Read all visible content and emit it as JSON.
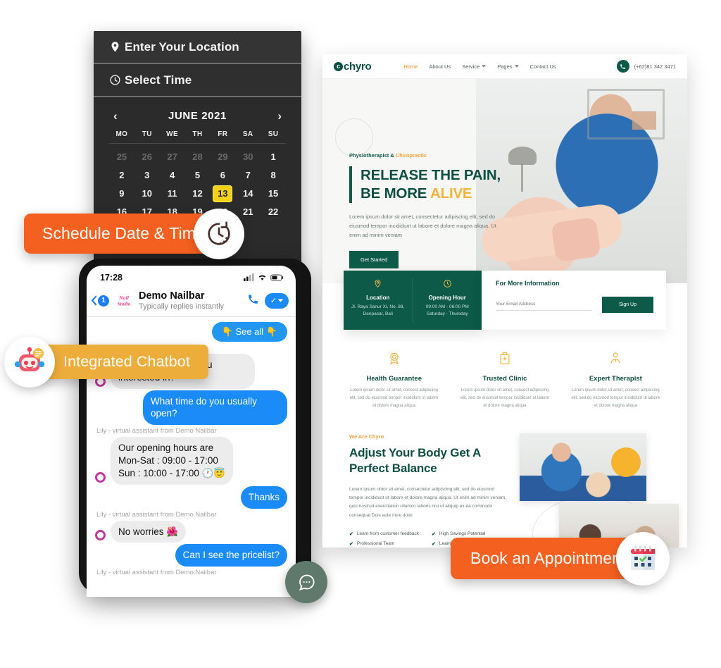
{
  "scheduler": {
    "location_row": {
      "label": "Enter Your Location",
      "icon": "map-pin-icon"
    },
    "time_row": {
      "label": "Select Time",
      "icon": "clock-icon"
    },
    "calendar": {
      "month_label": "JUNE 2021",
      "prev": "‹",
      "next": "›",
      "day_headers": [
        "MO",
        "TU",
        "WE",
        "TH",
        "FR",
        "SA",
        "SU"
      ],
      "weeks": [
        [
          {
            "d": "25",
            "muted": true
          },
          {
            "d": "26",
            "muted": true
          },
          {
            "d": "27",
            "muted": true
          },
          {
            "d": "28",
            "muted": true
          },
          {
            "d": "29",
            "muted": true
          },
          {
            "d": "30",
            "muted": true
          },
          {
            "d": "1",
            "muted": false
          }
        ],
        [
          {
            "d": "2"
          },
          {
            "d": "3"
          },
          {
            "d": "4"
          },
          {
            "d": "5"
          },
          {
            "d": "6"
          },
          {
            "d": "7"
          },
          {
            "d": "8"
          }
        ],
        [
          {
            "d": "9"
          },
          {
            "d": "10"
          },
          {
            "d": "11"
          },
          {
            "d": "12"
          },
          {
            "d": "13",
            "selected": true
          },
          {
            "d": "14"
          },
          {
            "d": "15"
          }
        ],
        [
          {
            "d": "16"
          },
          {
            "d": "17"
          },
          {
            "d": "18"
          },
          {
            "d": "19"
          },
          {
            "d": "20"
          },
          {
            "d": "21"
          },
          {
            "d": "22"
          }
        ]
      ],
      "selected_day": "13",
      "selected_color": "#f5d214"
    }
  },
  "phone": {
    "status": {
      "time": "17:28",
      "signal": "signal-icon",
      "wifi": "wifi-icon",
      "battery": "battery-icon"
    },
    "header": {
      "back_badge": "1",
      "brand_logo": "Nail Studio",
      "title": "Demo Nailbar",
      "subtitle": "Typically replies instantly",
      "call_icon": "phone-icon",
      "check_label": "✓"
    },
    "see_all": "👇 See all 👇",
    "messages": [
      {
        "sender": "Demo Nailbar",
        "side": "them",
        "text": "What services are you interested in?"
      },
      {
        "sender": "",
        "side": "me",
        "text": "What time do you usually open?"
      },
      {
        "sender": "Lily - virtual assistant from Demo Nailbar",
        "side": "them",
        "text": "Our opening hours are\nMon-Sat : 09:00 - 17:00\nSun : 10:00 - 17:00 🕐😇"
      },
      {
        "sender": "",
        "side": "me",
        "text": "Thanks"
      },
      {
        "sender": "Lily - virtual assistant from Demo Nailbar",
        "side": "them",
        "text": "No worries 🌺"
      },
      {
        "sender": "",
        "side": "me",
        "text": "Can I see the pricelist?"
      },
      {
        "sender": "Lily - virtual assistant from Demo Nailbar",
        "side": "them",
        "text": ""
      }
    ],
    "fab_icon": "chat-bubble-icon"
  },
  "site": {
    "nav": {
      "logo": "chyro",
      "links": [
        {
          "label": "Home",
          "active": true,
          "caret": false
        },
        {
          "label": "About Us",
          "active": false,
          "caret": false
        },
        {
          "label": "Service",
          "active": false,
          "caret": true
        },
        {
          "label": "Pages",
          "active": false,
          "caret": true
        },
        {
          "label": "Contact Us",
          "active": false,
          "caret": false
        }
      ],
      "phone_icon": "phone-icon",
      "phone_number": "(+62)81 342 3471"
    },
    "hero": {
      "eyebrow_a": "Physiotherapist & ",
      "eyebrow_b": "Chiropractic",
      "title_line1": "RELEASE THE PAIN,",
      "title_line2a": "BE MORE ",
      "title_line2b": "ALIVE",
      "paragraph": "Lorem ipsum dolor sit amet, consectetur adipiscing elit, sed do eiusmod tempor incididunt ut labore et dolore magna aliqua. Ut enim ad minim veniam",
      "cta": "Get Started"
    },
    "infobar": {
      "location": {
        "icon": "map-pin-icon",
        "title": "Location",
        "detail": "Jl. Raya Sanur XI, No. 88, Denpasar, Bali"
      },
      "hours": {
        "icon": "clock-icon",
        "title": "Opening Hour",
        "detail": "09:00 AM - 06:00 PM Saturday - Thursday"
      },
      "form": {
        "title": "For More Information",
        "placeholder": "Your Email Address",
        "button": "Sign Up"
      }
    },
    "features": [
      {
        "icon": "medal-icon",
        "title": "Health Guarantee",
        "text": "Lorem ipsum dolor sit amet, consect adipiscing elit, sed do eiusmod tempor incididunt ut labore et dolore magna aliqua"
      },
      {
        "icon": "clinic-icon",
        "title": "Trusted Clinic",
        "text": "Lorem ipsum dolor sit amet, consect adipiscing elit, sed do eiusmod tempor incididunt ut labore et dolore magna aliqua"
      },
      {
        "icon": "therapist-icon",
        "title": "Expert Therapist",
        "text": "Lorem ipsum dolor sit amet, consect adipiscing elit, sed do eiusmod tempor incididunt ut labore et dolore magna aliqua"
      }
    ],
    "about": {
      "eyebrow": "We Are Chyro",
      "title": "Adjust Your Body Get A Perfect Balance",
      "paragraph": "Lorem ipsum dolor sit amet, consectetur adipiscing elit, sed do eiusmod tempor incididunt ut labore et dolore magna aliqua. Ut enim ad minim veniam, quis nostrud exercitation ullamco laboris nisi ut aliquip ex ea commodo consequat Duis aute irure dolor",
      "checklist": [
        "Learn from customer feedback",
        "High Savings Potential",
        "Professional Team",
        "Learn from"
      ]
    }
  },
  "badges": {
    "schedule": {
      "label": "Schedule Date & Time",
      "icon": "clock-history-icon",
      "color": "#f4601f"
    },
    "chatbot": {
      "label": "Integrated Chatbot",
      "icon": "robot-icon",
      "color": "#edad3a"
    },
    "book": {
      "label": "Book an Appointment",
      "icon": "calendar-check-icon",
      "color": "#f4601f"
    }
  }
}
